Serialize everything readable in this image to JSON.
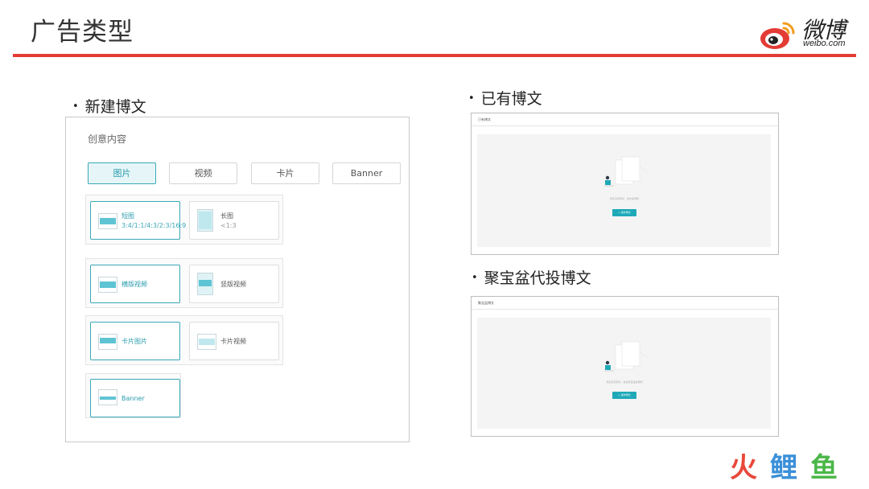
{
  "slide": {
    "title": "广告类型"
  },
  "brand": {
    "name": "微博",
    "domain": "weibo.com",
    "accent": "#e33c35"
  },
  "sections": {
    "new_post": "新建博文",
    "existing_post": "已有博文",
    "jubaopen_post": "聚宝盆代投博文"
  },
  "creative_panel": {
    "heading": "创意内容",
    "tabs": [
      "图片",
      "视频",
      "卡片",
      "Banner"
    ],
    "active_tab": "图片",
    "cards": {
      "short_image": {
        "label": "短图",
        "sub": "3:4/1:1/4:3/2:3/16:9"
      },
      "long_image": {
        "label": "长图",
        "sub": "<1:3"
      },
      "landscape_video": {
        "label": "横版视频"
      },
      "portrait_video": {
        "label": "竖版视频"
      },
      "card_image": {
        "label": "卡片图片"
      },
      "card_video": {
        "label": "卡片视频"
      },
      "banner": {
        "label": "Banner"
      }
    },
    "accent": "#3aa8b8"
  },
  "existing_screenshot": {
    "title": "已有博文",
    "empty_text": "你还没有博文，快去发博吧",
    "button": "+ 发布博文"
  },
  "jubaopen_screenshot": {
    "title": "聚宝盆博文",
    "empty_text": "你还没有博文，快去聚宝盆发博吧",
    "button": "+ 发布博文"
  },
  "footer_logo": {
    "chars": [
      "火",
      "鲤",
      "鱼"
    ],
    "colors": [
      "#e8483a",
      "#3a8fd8",
      "#4bb749"
    ]
  }
}
